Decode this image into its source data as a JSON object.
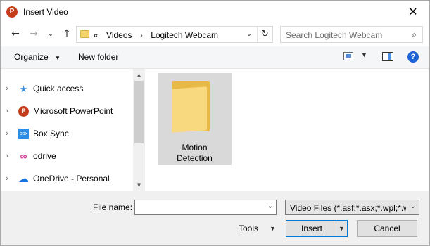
{
  "window": {
    "title": "Insert Video",
    "app_icon_letter": "P",
    "close_glyph": "✕"
  },
  "nav": {
    "back_glyph": "←",
    "forward_glyph": "→",
    "recent_glyph": "⌄",
    "up_glyph": "↑",
    "address": {
      "overflow": "«",
      "crumbs": [
        "Videos",
        "Logitech Webcam"
      ],
      "separator": "›",
      "dropdown_glyph": "⌄",
      "refresh_glyph": "↻"
    },
    "search": {
      "placeholder": "Search Logitech Webcam",
      "icon": "search-icon"
    }
  },
  "toolbar": {
    "organize_label": "Organize",
    "organize_caret": "▼",
    "new_folder_label": "New folder",
    "view_caret": "▼",
    "help_glyph": "?"
  },
  "sidebar": {
    "items": [
      {
        "label": "Quick access",
        "icon": "star-icon",
        "glyph": "★",
        "color": "#3d8fe0"
      },
      {
        "label": "Microsoft PowerPoint",
        "icon": "powerpoint-icon",
        "glyph": "P",
        "color": "#c43e1c"
      },
      {
        "label": "Box Sync",
        "icon": "box-icon",
        "glyph": "box",
        "color": "#2b8de6"
      },
      {
        "label": "odrive",
        "icon": "odrive-icon",
        "glyph": "∞",
        "color": "#d63a9a"
      },
      {
        "label": "OneDrive - Personal",
        "icon": "cloud-icon",
        "glyph": "☁",
        "color": "#1a73d9"
      }
    ],
    "chevron": "›"
  },
  "content": {
    "items": [
      {
        "label_line1": "Motion",
        "label_line2": "Detection",
        "type": "folder",
        "selected": true
      }
    ]
  },
  "bottom": {
    "file_name_label": "File name:",
    "file_name_value": "",
    "file_type_value": "Video Files (*.asf;*.asx;*.wpl;*.w",
    "tools_label": "Tools",
    "insert_label": "Insert",
    "cancel_label": "Cancel"
  },
  "colors": {
    "accent": "#0078d7",
    "folder": "#f9d97f",
    "selection": "#d9d9d9"
  }
}
